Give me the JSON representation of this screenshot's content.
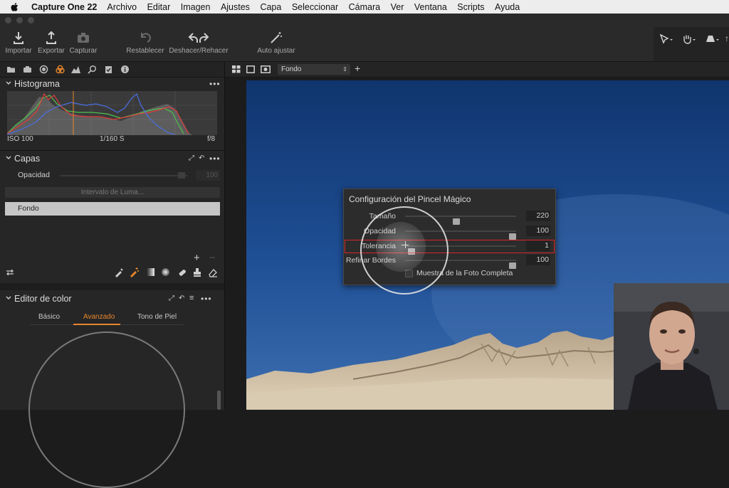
{
  "menubar": {
    "app": "Capture One 22",
    "items": [
      "Archivo",
      "Editar",
      "Imagen",
      "Ajustes",
      "Capa",
      "Seleccionar",
      "Cámara",
      "Ver",
      "Ventana",
      "Scripts",
      "Ayuda"
    ]
  },
  "toolbar": {
    "importar": "Importar",
    "exportar": "Exportar",
    "capturar": "Capturar",
    "restablecer": "Restablecer",
    "deshacer_rehacer": "Deshacer/Rehacer",
    "auto_ajustar": "Auto ajustar"
  },
  "histogram": {
    "title": "Histograma",
    "iso": "ISO 100",
    "shutter": "1/160 S",
    "aperture": "f/8"
  },
  "layers": {
    "title": "Capas",
    "opacity_label": "Opacidad",
    "opacity_value": "100",
    "luma_button": "Intervalo de Luma...",
    "layer_name": "Fondo",
    "add": "+",
    "remove": "−"
  },
  "color_editor": {
    "title": "Editor de color",
    "tabs": [
      "Básico",
      "Avanzado",
      "Tono de Piel"
    ],
    "active_tab": "Avanzado"
  },
  "viewer": {
    "layer_select": "Fondo"
  },
  "dialog": {
    "title": "Configuración del Pincel Mágico",
    "rows": [
      {
        "label": "Tamaño",
        "value": "220",
        "fraction": 0.46
      },
      {
        "label": "Opacidad",
        "value": "100",
        "fraction": 1.0
      },
      {
        "label": "Tolerancia",
        "value": "1",
        "fraction": 0.03
      },
      {
        "label": "Refinar Bordes",
        "value": "100",
        "fraction": 1.0
      }
    ],
    "checkbox_label": "Muestra de la Foto Completa"
  },
  "colors": {
    "accent_orange": "#e8862c",
    "highlight_red": "#d9262a"
  }
}
